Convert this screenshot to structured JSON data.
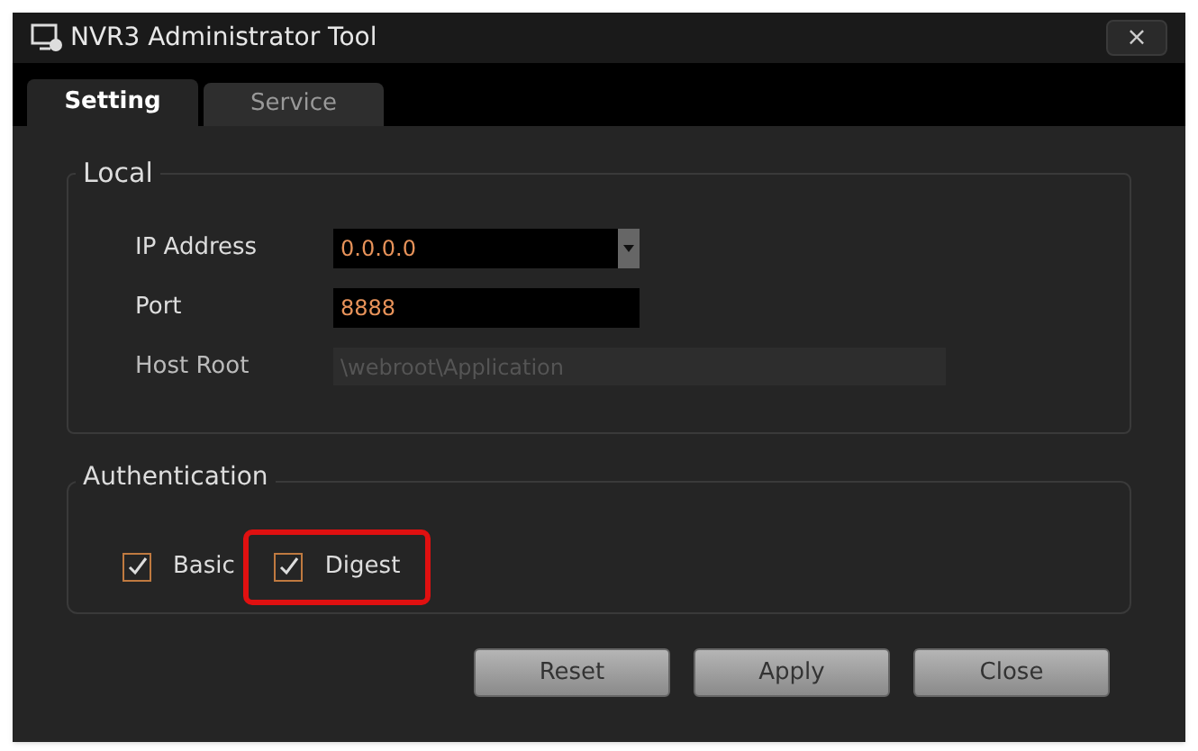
{
  "window": {
    "title": "NVR3 Administrator Tool",
    "close": "×"
  },
  "tabs": [
    {
      "label": "Setting",
      "selected": true
    },
    {
      "label": "Service",
      "selected": false
    }
  ],
  "local": {
    "title": "Local",
    "fields": [
      {
        "label": "IP Address",
        "value": "0.0.0.0",
        "kind": "dropdown",
        "disabled": false
      },
      {
        "label": "Port",
        "value": "8888",
        "kind": "text",
        "disabled": false
      },
      {
        "label": "Host Root",
        "value": "\\webroot\\Application",
        "kind": "text",
        "disabled": true
      }
    ]
  },
  "authentication": {
    "title": "Authentication",
    "options": [
      {
        "label": "Basic",
        "checked": true,
        "highlighted": false
      },
      {
        "label": "Digest",
        "checked": true,
        "highlighted": true
      }
    ]
  },
  "buttons": [
    "Reset",
    "Apply",
    "Close"
  ]
}
